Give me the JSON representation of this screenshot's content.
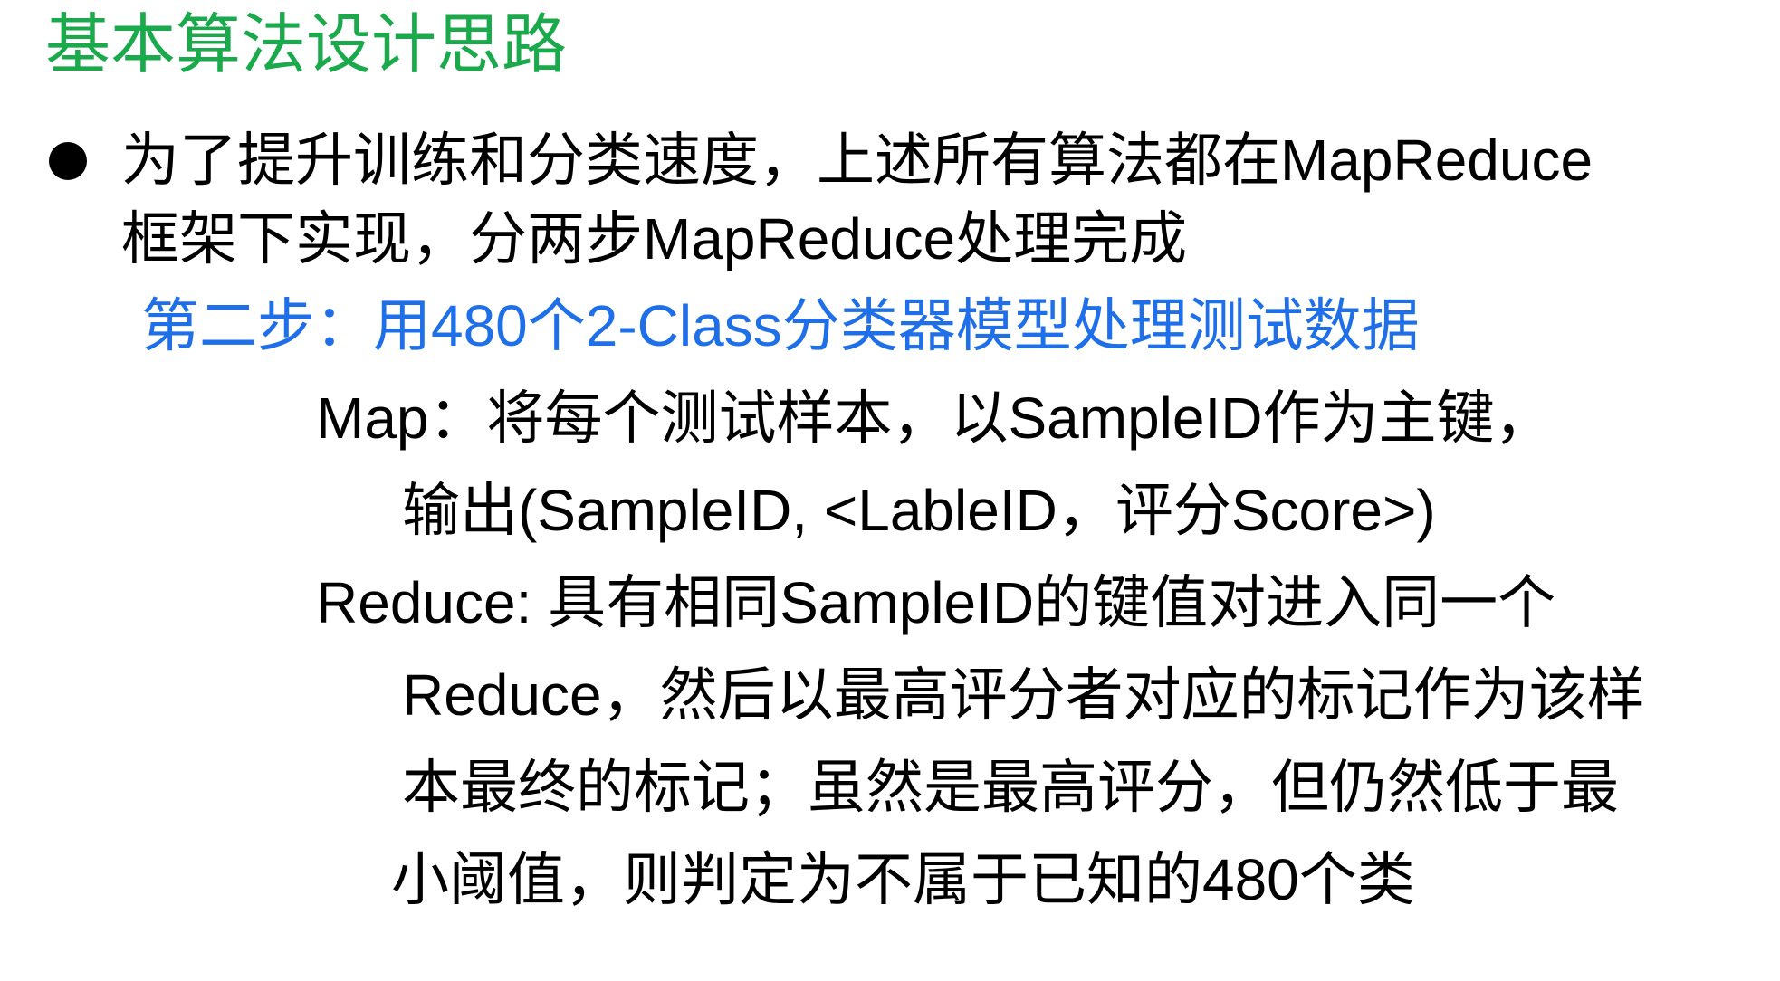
{
  "slide": {
    "title": "基本算法设计思路",
    "bullet": {
      "line1": "为了提升训练和分类速度，上述所有算法都在MapReduce",
      "line2": "框架下实现，分两步MapReduce处理完成"
    },
    "step": "第二步：用480个2-Class分类器模型处理测试数据",
    "details": [
      "Map：将每个测试样本，以SampleID作为主键，",
      "输出(SampleID, <LableID，评分Score>)",
      "Reduce: 具有相同SampleID的键值对进入同一个",
      "Reduce，然后以最高评分者对应的标记作为该样",
      "本最终的标记；虽然是最高评分，但仍然低于最",
      "小阈值，则判定为不属于已知的480个类"
    ],
    "colors": {
      "title": "#1aa94b",
      "step": "#1f6fe8",
      "text": "#000000"
    }
  }
}
